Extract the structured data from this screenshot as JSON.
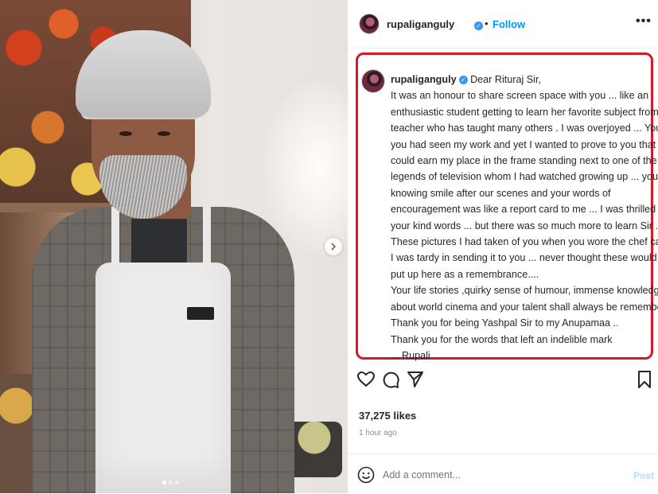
{
  "header": {
    "username": "rupaliganguly",
    "separator": "•",
    "follow_label": "Follow",
    "more_label": "•••"
  },
  "caption": {
    "username": "rupaliganguly",
    "greeting": "Dear Rituraj Sir,",
    "lines": [
      "It was an honour to share screen space with you ... like an",
      "enthusiastic student getting to learn her favorite subject from a",
      "teacher who has taught many others . I was overjoyed ... You said",
      "you had seen my work and yet I wanted to prove to you that I",
      "could earn my place in the frame standing next to one of the",
      "legends of television whom I had watched growing up ... your all",
      "knowing smile after our scenes and your words of",
      "encouragement was like a report card to me ... I was thrilled by",
      "your kind words ... but there was so much more to learn Sir ....",
      "These pictures I had taken of you when you wore the chef cap ...",
      "I was tardy in sending it to you ... never thought these would be",
      "put up here as a remembrance....",
      "Your life stories ,quirky sense of humour, immense knowledge",
      "about world cinema and your talent shall always be remembered",
      "Thank you for being Yashpal Sir to my Anupamaa ..",
      "Thank you for the words that left an indelible mark",
      "... Rupali"
    ]
  },
  "photo": {
    "apron_tag": "Chef",
    "next_icon": "chevron-right-icon"
  },
  "engagement": {
    "likes": "37,275 likes",
    "time": "1 hour ago"
  },
  "comment": {
    "placeholder": "Add a comment...",
    "post_label": "Post"
  },
  "colors": {
    "accent": "#0095f6",
    "highlight_border": "#d11a2a",
    "verified": "#3897f0"
  }
}
